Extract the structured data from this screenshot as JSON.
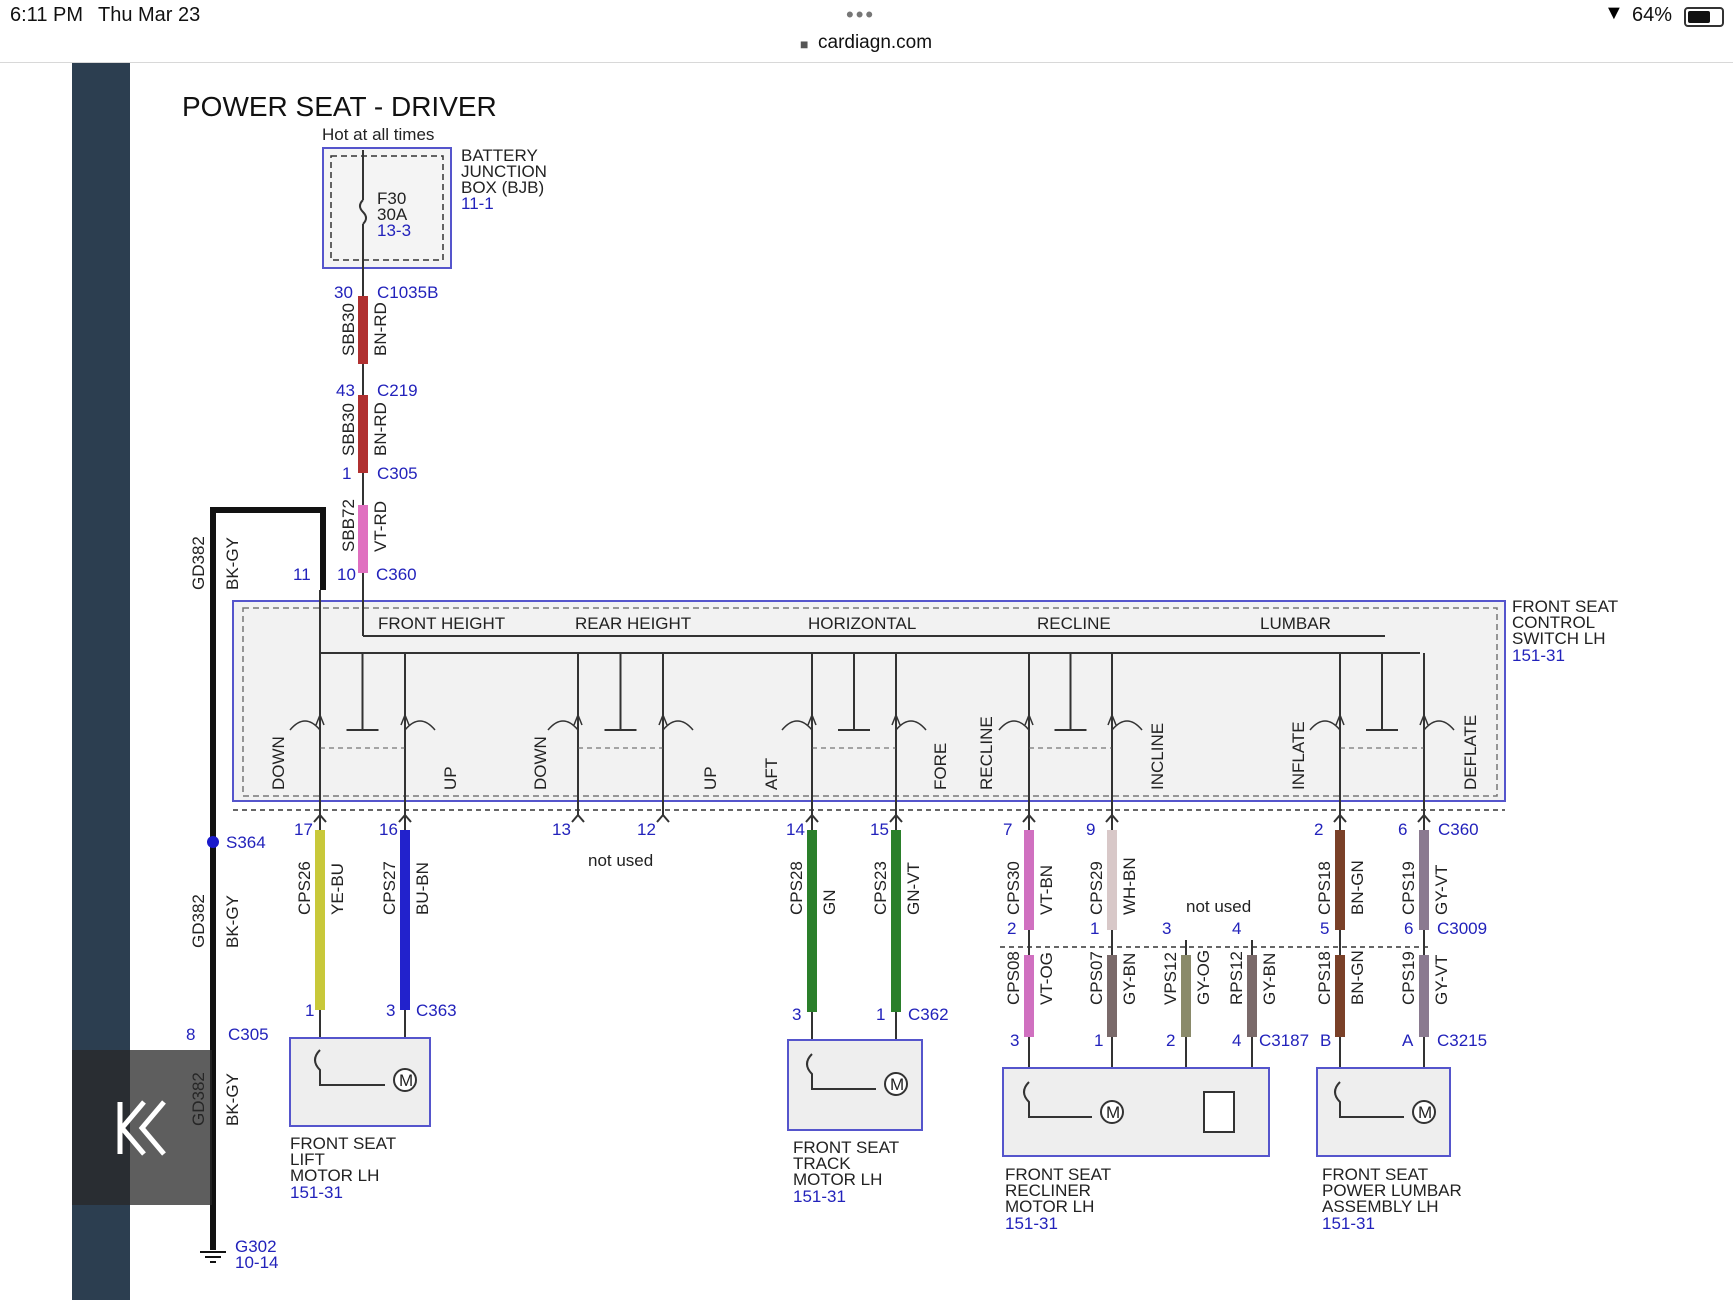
{
  "status": {
    "time": "6:11 PM",
    "date": "Thu Mar 23",
    "url": "cardiagn.com",
    "battery": "64%"
  },
  "title": "POWER SEAT - DRIVER",
  "fuse": {
    "hot": "Hot at all times",
    "box_label": [
      "BATTERY",
      "JUNCTION",
      "BOX (BJB)"
    ],
    "box_ref": "11-1",
    "fuse_id": "F30",
    "fuse_amp": "30A",
    "fuse_ref": "13-3"
  },
  "feed": {
    "c1_pin": "30",
    "c1": "C1035B",
    "w1": "SBB30",
    "w1c": "BN-RD",
    "c2_pin": "43",
    "c2": "C219",
    "w2": "SBB30",
    "w2c": "BN-RD",
    "c3_pin": "1",
    "c3": "C305",
    "w3": "SBB72",
    "w3c": "VT-RD",
    "c4_pin": "10",
    "c4": "C360",
    "c4_gnd_pin": "11"
  },
  "switch": {
    "label": [
      "FRONT SEAT",
      "CONTROL",
      "SWITCH LH"
    ],
    "ref": "151-31",
    "groups": [
      "FRONT HEIGHT",
      "REAR HEIGHT",
      "HORIZONTAL",
      "RECLINE",
      "LUMBAR"
    ],
    "contacts": [
      "DOWN",
      "UP",
      "DOWN",
      "UP",
      "AFT",
      "FORE",
      "RECLINE",
      "INCLINE",
      "INFLATE",
      "DEFLATE"
    ],
    "out_pins": [
      "17",
      "16",
      "13",
      "12",
      "14",
      "15",
      "7",
      "9",
      "2",
      "6"
    ],
    "out_conn": "C360",
    "not_used": "not used"
  },
  "ground": {
    "w": "GD382",
    "wc": "BK-GY",
    "splice": "S364",
    "c_pin": "8",
    "c": "C305",
    "g": "G302",
    "g_ref": "10-14"
  },
  "wires": [
    {
      "id": "CPS26",
      "color": "YE-BU",
      "hex": "#c8c83a"
    },
    {
      "id": "CPS27",
      "color": "BU-BN",
      "hex": "#2222cc"
    },
    {
      "id": "CPS28",
      "color": "GN",
      "hex": "#2a7f2a"
    },
    {
      "id": "CPS23",
      "color": "GN-VT",
      "hex": "#2a7f2a"
    },
    {
      "id": "CPS30",
      "color": "VT-BN",
      "hex": "#d070c0"
    },
    {
      "id": "CPS29",
      "color": "WH-BN",
      "hex": "#d8c8c8"
    },
    {
      "id": "CPS18",
      "color": "BN-GN",
      "hex": "#7a4028"
    },
    {
      "id": "CPS19",
      "color": "GY-VT",
      "hex": "#8a7a90"
    }
  ],
  "lower_wires": [
    {
      "id": "CPS08",
      "color": "VT-OG",
      "hex": "#d070c0"
    },
    {
      "id": "CPS07",
      "color": "GY-BN",
      "hex": "#7a6a6a"
    },
    {
      "id": "VPS12",
      "color": "GY-OG",
      "hex": "#8a8a6a"
    },
    {
      "id": "RPS12",
      "color": "GY-BN",
      "hex": "#7a6a6a"
    },
    {
      "id": "CPS18",
      "color": "BN-GN",
      "hex": "#7a4028"
    },
    {
      "id": "CPS19",
      "color": "GY-VT",
      "hex": "#8a7a90"
    }
  ],
  "c363": {
    "p1": "1",
    "p2": "3",
    "c": "C363"
  },
  "c362": {
    "p1": "3",
    "p2": "1",
    "c": "C362"
  },
  "c3009": {
    "pins": [
      "2",
      "1",
      "3",
      "4",
      "5",
      "6"
    ],
    "c": "C3009",
    "not_used": "not used"
  },
  "c3187": {
    "pins": [
      "3",
      "1",
      "2",
      "4"
    ],
    "c": "C3187"
  },
  "c3215": {
    "pins": [
      "B",
      "A"
    ],
    "c": "C3215"
  },
  "motors": [
    {
      "label": [
        "FRONT SEAT",
        "LIFT",
        "MOTOR LH"
      ],
      "ref": "151-31"
    },
    {
      "label": [
        "FRONT SEAT",
        "TRACK",
        "MOTOR LH"
      ],
      "ref": "151-31"
    },
    {
      "label": [
        "FRONT SEAT",
        "RECLINER",
        "MOTOR LH"
      ],
      "ref": "151-31"
    },
    {
      "label": [
        "FRONT SEAT",
        "POWER LUMBAR",
        "ASSEMBLY LH"
      ],
      "ref": "151-31"
    }
  ],
  "nav": {
    "back_icon": "double-chevron-left-icon"
  }
}
